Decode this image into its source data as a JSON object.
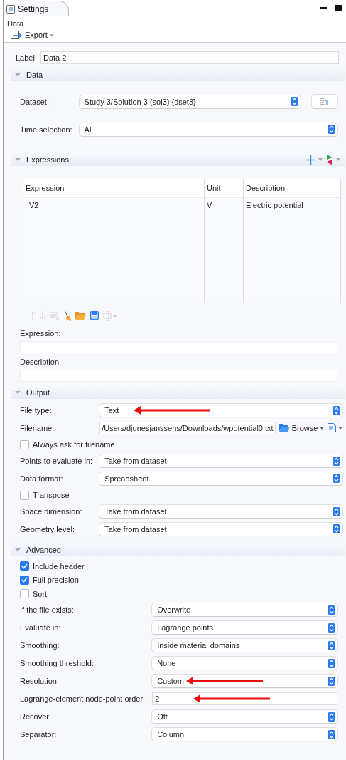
{
  "panel": {
    "tab": "Settings",
    "title": "Data",
    "toolbar": {
      "label": "Export"
    }
  },
  "label_field": {
    "label": "Label:",
    "value": "Data 2"
  },
  "sections": [
    {
      "kind": "form",
      "title": "Data",
      "expanded": true,
      "rows": [
        {
          "kind": "select",
          "label": "Dataset:",
          "value": "Study 3/Solution 3 (sol3) {dset3}",
          "side_button": true
        },
        {
          "kind": "select",
          "label": "Time selection:",
          "value": "All"
        }
      ]
    },
    {
      "kind": "expressions",
      "title": "Expressions",
      "expanded": true,
      "table": {
        "columns": [
          "Expression",
          "Unit",
          "Description"
        ],
        "rows": [
          [
            "V2",
            "V",
            "Electric potential"
          ]
        ]
      },
      "fields": [
        {
          "label": "Expression:"
        },
        {
          "label": "Description:"
        }
      ]
    },
    {
      "kind": "form",
      "title": "Output",
      "expanded": true,
      "rows": [
        {
          "kind": "select",
          "label": "File type:",
          "value": "Text",
          "annotated": true
        },
        {
          "kind": "filename",
          "label": "Filename:",
          "value": "/Users/djunesjanssens/Downloads/wpotential0.txt",
          "browse": "Browse"
        },
        {
          "kind": "checkbox",
          "label": "Always ask for filename",
          "checked": false
        },
        {
          "kind": "select",
          "label": "Points to evaluate in:",
          "value": "Take from dataset"
        },
        {
          "kind": "select",
          "label": "Data format:",
          "value": "Spreadsheet"
        },
        {
          "kind": "checkbox",
          "label": "Transpose",
          "checked": false
        },
        {
          "kind": "select",
          "label": "Space dimension:",
          "value": "Take from dataset"
        },
        {
          "kind": "select",
          "label": "Geometry level:",
          "value": "Take from dataset"
        }
      ]
    },
    {
      "kind": "form",
      "title": "Advanced",
      "expanded": true,
      "rows": [
        {
          "kind": "checkbox",
          "label": "Include header",
          "checked": true
        },
        {
          "kind": "checkbox",
          "label": "Full precision",
          "checked": true
        },
        {
          "kind": "checkbox",
          "label": "Sort",
          "checked": false
        },
        {
          "kind": "select",
          "label": "If the file exists:",
          "value": "Overwrite"
        },
        {
          "kind": "select",
          "label": "Evaluate in:",
          "value": "Lagrange points"
        },
        {
          "kind": "select",
          "label": "Smoothing:",
          "value": "Inside material domains"
        },
        {
          "kind": "select",
          "label": "Smoothing threshold:",
          "value": "None"
        },
        {
          "kind": "select",
          "label": "Resolution:",
          "value": "Custom",
          "annotated": true
        },
        {
          "kind": "text",
          "label": "Lagrange-element node-point order:",
          "value": "2",
          "annotated": true
        },
        {
          "kind": "select",
          "label": "Recover:",
          "value": "Off"
        },
        {
          "kind": "select",
          "label": "Separator:",
          "value": "Column"
        }
      ]
    }
  ]
}
